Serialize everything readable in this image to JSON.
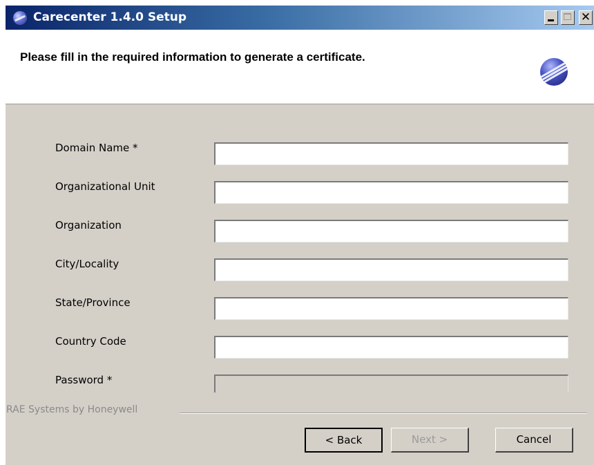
{
  "window": {
    "title": "Carecenter 1.4.0 Setup",
    "buttons": {
      "minimize": "_",
      "maximize": "□",
      "close": "✕"
    }
  },
  "header": {
    "instruction": "Please fill in the required information to generate a certificate."
  },
  "form": {
    "fields": [
      {
        "label": "Domain Name *",
        "value": "",
        "enabled": true
      },
      {
        "label": "Organizational Unit",
        "value": "",
        "enabled": true
      },
      {
        "label": "Organization",
        "value": "",
        "enabled": true
      },
      {
        "label": "City/Locality",
        "value": "",
        "enabled": true
      },
      {
        "label": "State/Province",
        "value": "",
        "enabled": true
      },
      {
        "label": "Country Code",
        "value": "",
        "enabled": true
      },
      {
        "label": "Password *",
        "value": "",
        "enabled": false
      }
    ]
  },
  "footer": {
    "brand": "RAE Systems by Honeywell",
    "back_label": "< Back",
    "next_label": "Next >",
    "cancel_label": "Cancel"
  },
  "icons": {
    "app": "carecenter-logo-icon",
    "header": "carecenter-globe-icon"
  },
  "colors": {
    "title_gradient_start": "#0a246a",
    "title_gradient_end": "#a6caf0",
    "dialog_face": "#d4d0c8",
    "disabled_text": "#9a9a9a"
  }
}
